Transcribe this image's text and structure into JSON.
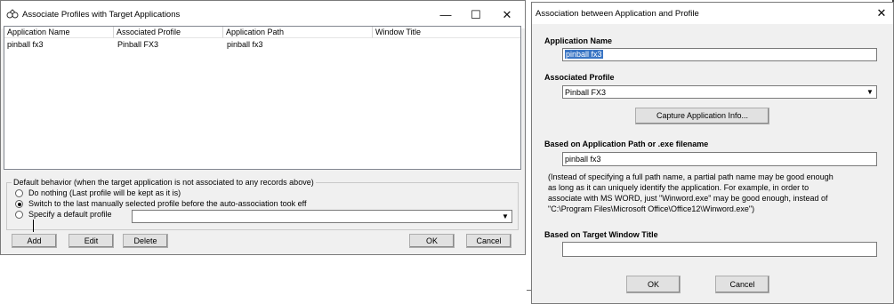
{
  "left_window": {
    "title": "Associate Profiles with Target Applications",
    "controls": {
      "minimize": "—",
      "maximize": "☐",
      "close": "✕"
    },
    "columns": [
      "Application Name",
      "Associated Profile",
      "Application Path",
      "Window Title"
    ],
    "rows": [
      {
        "name": "pinball fx3",
        "profile": "Pinball FX3",
        "path": "pinball fx3",
        "title": ""
      }
    ],
    "group_label": "Default behavior (when the target application is not associated to any records above)",
    "options": [
      {
        "label": "Do nothing (Last profile will be kept as it is)",
        "selected": false
      },
      {
        "label": "Switch to the last manually selected profile before the auto-association took eff",
        "selected": true
      },
      {
        "label": "Specify a default profile",
        "selected": false
      }
    ],
    "default_profile_value": "",
    "buttons": {
      "add": "Add",
      "edit": "Edit",
      "delete": "Delete",
      "ok": "OK",
      "cancel": "Cancel"
    }
  },
  "right_window": {
    "title": "Association between Application and Profile",
    "close": "✕",
    "app_name_label": "Application Name",
    "app_name_value": "pinball fx3",
    "profile_label": "Associated Profile",
    "profile_value": "Pinball FX3",
    "capture_button": "Capture Application Info...",
    "path_label": "Based on Application Path or .exe filename",
    "path_value": "pinball fx3",
    "note_lines": [
      "(Instead of specifying a full path name, a partial path name may be good enough",
      "as long as it can uniquely identify the application.  For example, in order to",
      "associate with MS WORD, just \"Winword.exe\" may be good enough, instead of",
      "\"C:\\Program Files\\Microsoft Office\\Office12\\Winword.exe\")"
    ],
    "window_title_label": "Based on Target Window Title",
    "window_title_value": "",
    "ok_button": "OK",
    "cancel_button": "Cancel"
  }
}
